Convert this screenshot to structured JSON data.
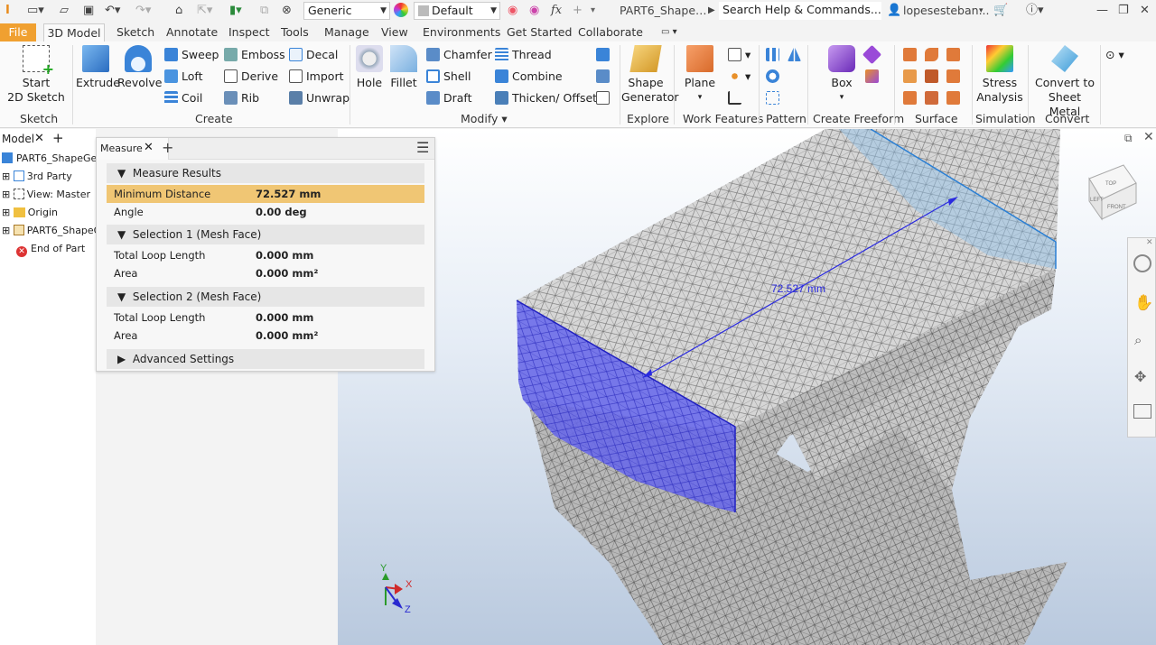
{
  "quick_access": {
    "appearance": "Generic",
    "material": "Default",
    "doc_title": "PART6_Shape…",
    "search_placeholder": "Search Help & Commands...",
    "user": "lopesesteban..."
  },
  "tabs": [
    "File",
    "3D Model",
    "Sketch",
    "Annotate",
    "Inspect",
    "Tools",
    "Manage",
    "View",
    "Environments",
    "Get Started",
    "Collaborate"
  ],
  "ribbon": {
    "sketch": {
      "start_sketch": "Start",
      "start_sketch2": "2D Sketch",
      "group": "Sketch"
    },
    "create": {
      "extrude": "Extrude",
      "revolve": "Revolve",
      "sweep": "Sweep",
      "emboss": "Emboss",
      "decal": "Decal",
      "loft": "Loft",
      "derive": "Derive",
      "import": "Import",
      "coil": "Coil",
      "rib": "Rib",
      "unwrap": "Unwrap",
      "group": "Create"
    },
    "modify": {
      "hole": "Hole",
      "fillet": "Fillet",
      "chamfer": "Chamfer",
      "thread": "Thread",
      "shell": "Shell",
      "combine": "Combine",
      "draft": "Draft",
      "thicken": "Thicken/ Offset",
      "group": "Modify"
    },
    "explore": {
      "shape_gen": "Shape",
      "shape_gen2": "Generator",
      "group": "Explore"
    },
    "work": {
      "plane": "Plane",
      "group": "Work Features"
    },
    "pattern": {
      "group": "Pattern"
    },
    "freeform": {
      "box": "Box",
      "group": "Create Freeform"
    },
    "surface": {
      "group": "Surface"
    },
    "simulation": {
      "stress": "Stress",
      "stress2": "Analysis",
      "group": "Simulation"
    },
    "convert": {
      "to_sheet": "Convert to",
      "to_sheet2": "Sheet Metal",
      "group": "Convert"
    }
  },
  "browser": {
    "tab": "Model",
    "items": [
      "PART6_ShapeGene",
      "3rd Party",
      "View: Master",
      "Origin",
      "PART6_ShapeG",
      "End of Part"
    ]
  },
  "measure": {
    "tab": "Measure",
    "results_header": "Measure Results",
    "min_distance_label": "Minimum Distance",
    "min_distance_value": "72.527 mm",
    "angle_label": "Angle",
    "angle_value": "0.00 deg",
    "sel1_header": "Selection 1 (Mesh Face)",
    "sel1_loop_label": "Total Loop Length",
    "sel1_loop_value": "0.000 mm",
    "sel1_area_label": "Area",
    "sel1_area_value": "0.000 mm²",
    "sel2_header": "Selection 2 (Mesh Face)",
    "sel2_loop_label": "Total Loop Length",
    "sel2_loop_value": "0.000 mm",
    "sel2_area_label": "Area",
    "sel2_area_value": "0.000 mm²",
    "advanced": "Advanced Settings"
  },
  "viewport": {
    "dimension_label": "72.527 mm",
    "viewcube_top": "TOP",
    "viewcube_front": "FRONT",
    "viewcube_left": "LEFT",
    "axis_x": "X",
    "axis_y": "Y",
    "axis_z": "Z"
  },
  "colors": {
    "accent": "#f0a030",
    "highlight_row": "#f0c674",
    "selection": "#3a3ae8"
  }
}
